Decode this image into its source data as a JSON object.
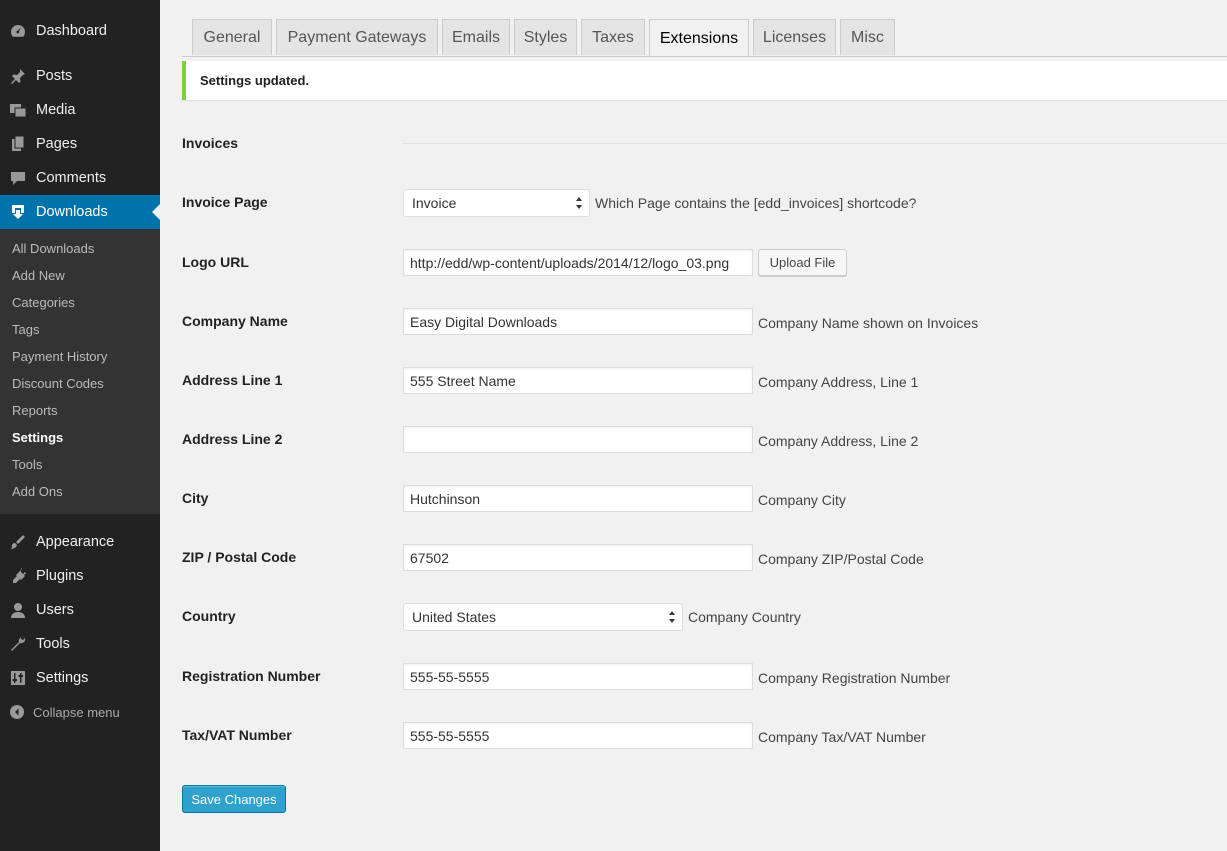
{
  "sidebar": {
    "items": [
      {
        "label": "Dashboard",
        "icon": "dashboard-icon"
      },
      {
        "label": "Posts",
        "icon": "pin-icon"
      },
      {
        "label": "Media",
        "icon": "media-icon"
      },
      {
        "label": "Pages",
        "icon": "pages-icon"
      },
      {
        "label": "Comments",
        "icon": "comment-icon"
      },
      {
        "label": "Downloads",
        "icon": "download-icon"
      },
      {
        "label": "Appearance",
        "icon": "brush-icon"
      },
      {
        "label": "Plugins",
        "icon": "plugin-icon"
      },
      {
        "label": "Users",
        "icon": "user-icon"
      },
      {
        "label": "Tools",
        "icon": "wrench-icon"
      },
      {
        "label": "Settings",
        "icon": "sliders-icon"
      }
    ],
    "submenu": [
      "All Downloads",
      "Add New",
      "Categories",
      "Tags",
      "Payment History",
      "Discount Codes",
      "Reports",
      "Settings",
      "Tools",
      "Add Ons"
    ],
    "collapse_label": "Collapse menu"
  },
  "tabs": [
    "General",
    "Payment Gateways",
    "Emails",
    "Styles",
    "Taxes",
    "Extensions",
    "Licenses",
    "Misc"
  ],
  "notice": "Settings updated.",
  "section_title": "Invoices",
  "fields": {
    "invoice_page": {
      "label": "Invoice Page",
      "value": "Invoice",
      "desc": "Which Page contains the [edd_invoices] shortcode?"
    },
    "logo_url": {
      "label": "Logo URL",
      "value": "http://edd/wp-content/uploads/2014/12/logo_03.png",
      "button": "Upload File"
    },
    "company_name": {
      "label": "Company Name",
      "value": "Easy Digital Downloads",
      "desc": "Company Name shown on Invoices"
    },
    "address1": {
      "label": "Address Line 1",
      "value": "555 Street Name",
      "desc": "Company Address, Line 1"
    },
    "address2": {
      "label": "Address Line 2",
      "value": "",
      "desc": "Company Address, Line 2"
    },
    "city": {
      "label": "City",
      "value": "Hutchinson",
      "desc": "Company City"
    },
    "zip": {
      "label": "ZIP / Postal Code",
      "value": "67502",
      "desc": "Company ZIP/Postal Code"
    },
    "country": {
      "label": "Country",
      "value": "United States",
      "desc": "Company Country"
    },
    "registration": {
      "label": "Registration Number",
      "value": "555-55-5555",
      "desc": "Company Registration Number"
    },
    "tax": {
      "label": "Tax/VAT Number",
      "value": "555-55-5555",
      "desc": "Company Tax/VAT Number"
    }
  },
  "save_label": "Save Changes",
  "colors": {
    "sidebar_bg": "#222222",
    "submenu_bg": "#333333",
    "accent": "#0073aa",
    "button": "#2ea2cc",
    "notice_border": "#7ad03a"
  }
}
